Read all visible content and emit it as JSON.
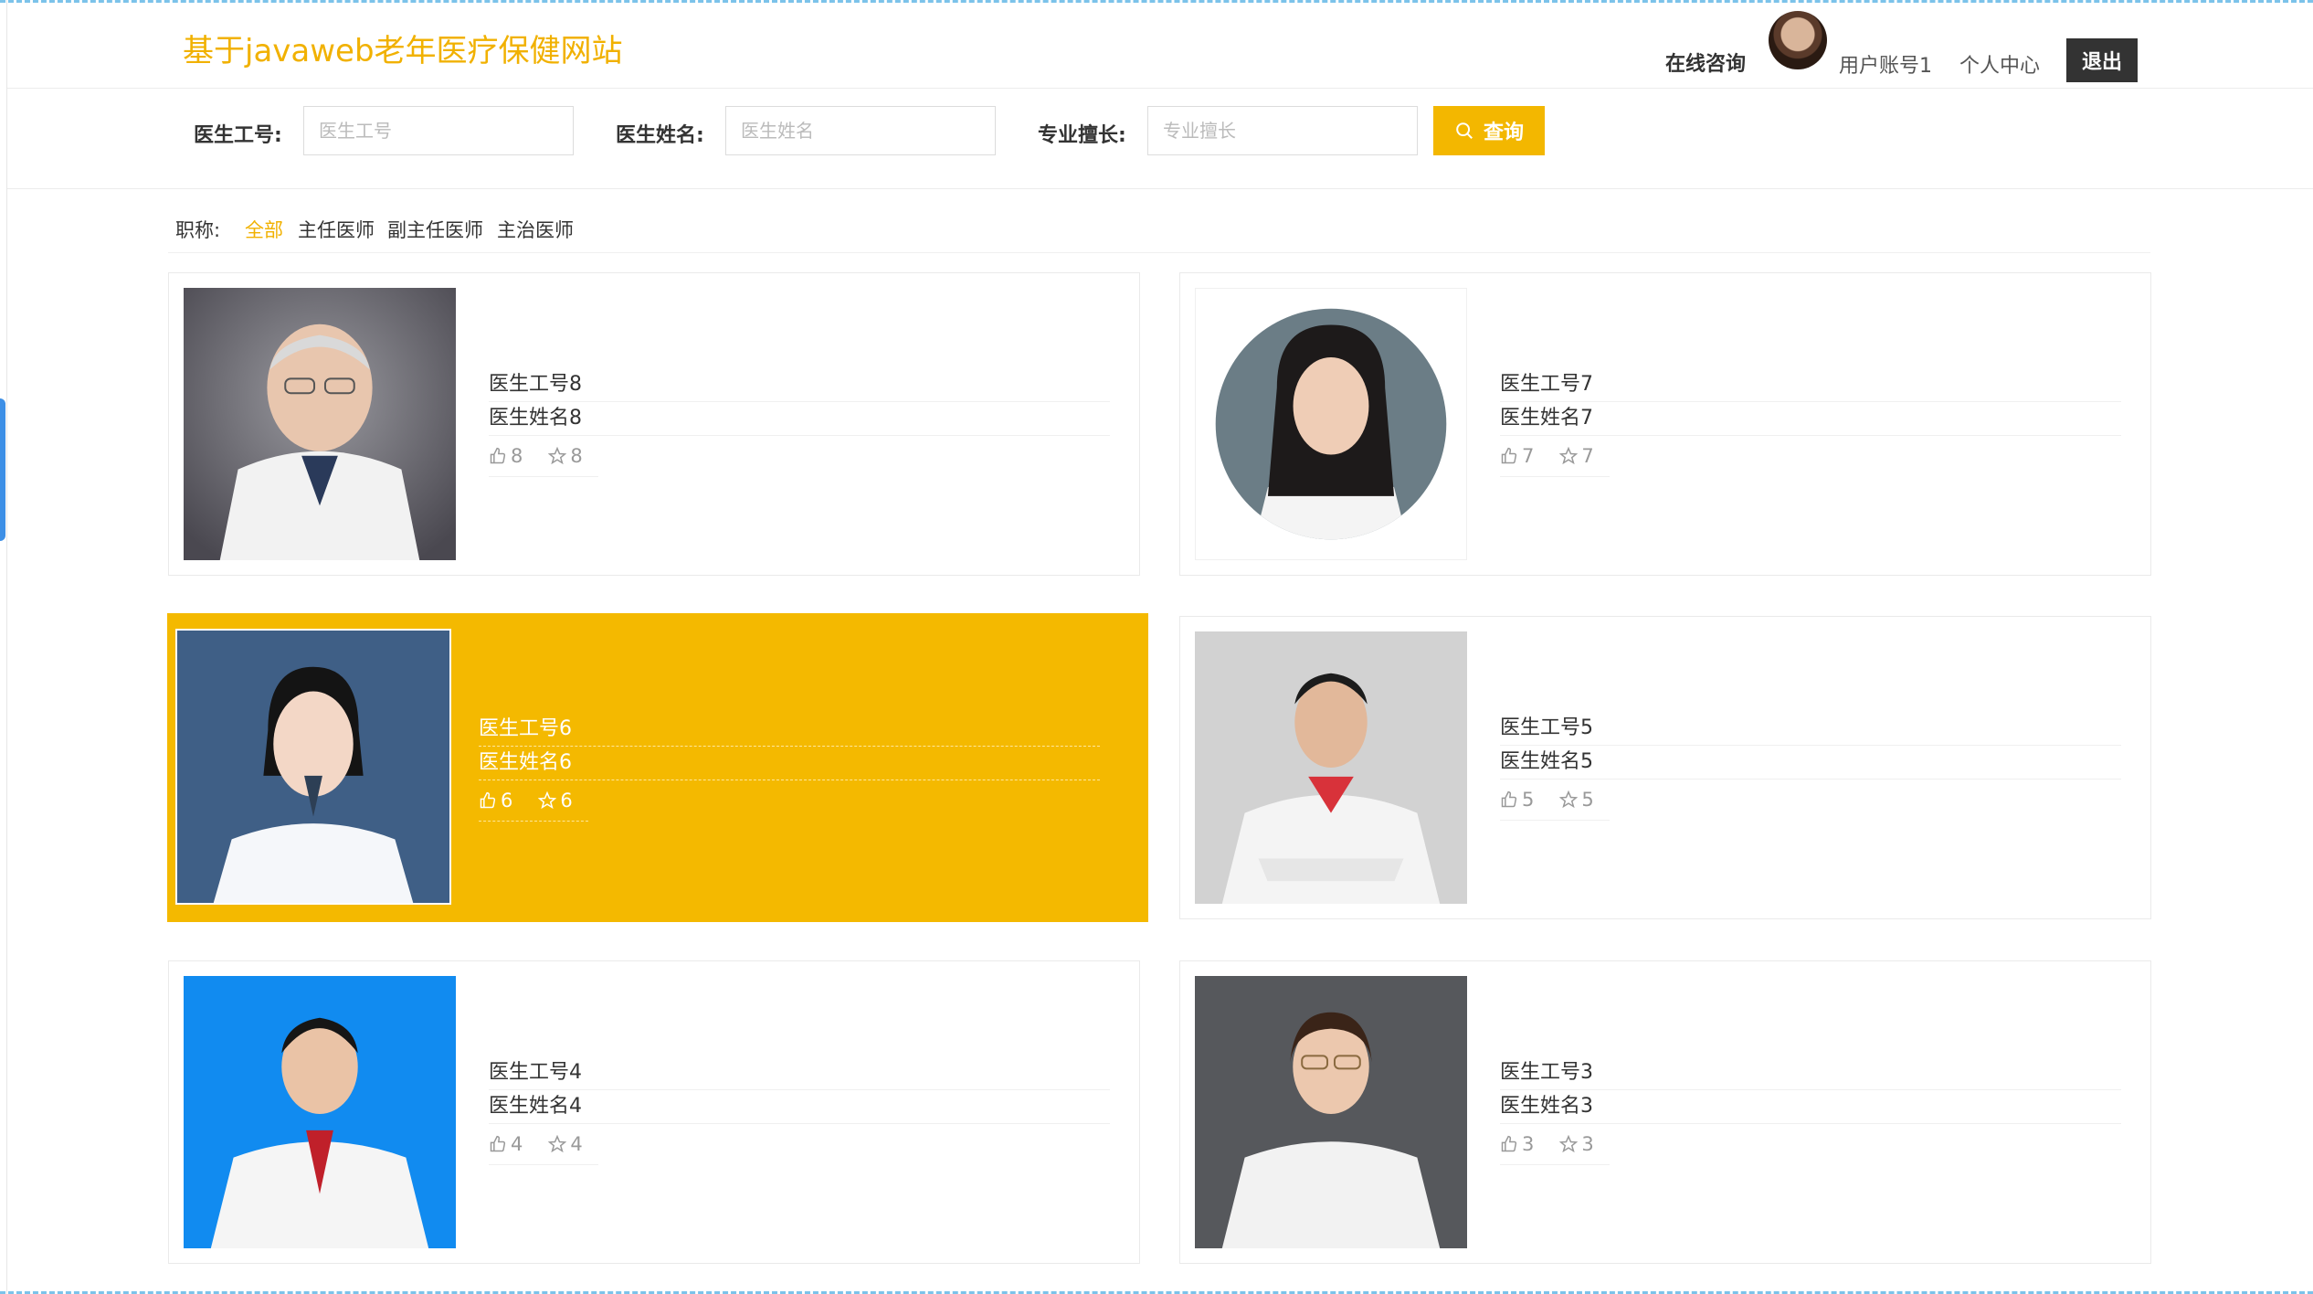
{
  "header": {
    "site_title": "基于javaweb老年医疗保健网站",
    "nav_consult": "在线咨询",
    "nav_account": "用户账号1",
    "nav_center": "个人中心",
    "logout": "退出"
  },
  "search": {
    "doctor_no_label": "医生工号:",
    "doctor_no_placeholder": "医生工号",
    "doctor_name_label": "医生姓名:",
    "doctor_name_placeholder": "医生姓名",
    "specialty_label": "专业擅长:",
    "specialty_placeholder": "专业擅长",
    "button_label": "查询"
  },
  "filter": {
    "label": "职称:",
    "items": [
      "全部",
      "主任医师",
      "副主任医师",
      "主治医师"
    ],
    "active_index": 0
  },
  "colors": {
    "accent": "#f4b900",
    "dark": "#333333"
  },
  "doctors": [
    {
      "no": "医生工号8",
      "name": "医生姓名8",
      "likes": "8",
      "stars": "8"
    },
    {
      "no": "医生工号7",
      "name": "医生姓名7",
      "likes": "7",
      "stars": "7"
    },
    {
      "no": "医生工号6",
      "name": "医生姓名6",
      "likes": "6",
      "stars": "6"
    },
    {
      "no": "医生工号5",
      "name": "医生姓名5",
      "likes": "5",
      "stars": "5"
    },
    {
      "no": "医生工号4",
      "name": "医生姓名4",
      "likes": "4",
      "stars": "4"
    },
    {
      "no": "医生工号3",
      "name": "医生姓名3",
      "likes": "3",
      "stars": "3"
    }
  ]
}
